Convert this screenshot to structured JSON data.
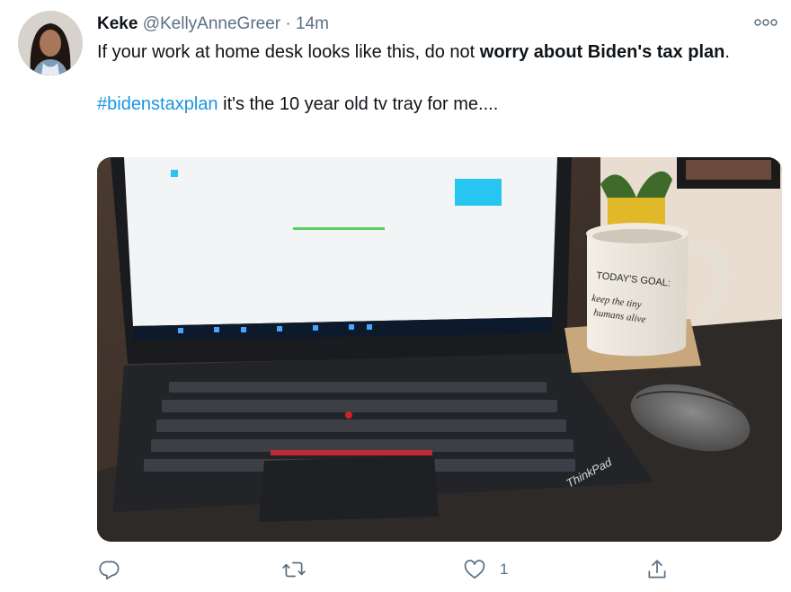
{
  "tweet": {
    "author_name": "Keke",
    "handle": "@KellyAnneGreer",
    "separator": "·",
    "time": "14m",
    "text_normal": "If your work at home desk looks like this, do not ",
    "text_bold": "worry about Biden's tax plan",
    "text_end": ".",
    "hashtag": "#bidenstaxplan",
    "text_line2": " it's the 10 year old tv tray for me....",
    "like_count": "1"
  },
  "photo": {
    "laptop_brand": "ThinkPad",
    "mug_line1": "TODAY'S GOAL:",
    "mug_line2": "keep the tiny",
    "mug_line3": "humans alive"
  },
  "icons": {
    "more": "more-icon",
    "reply": "reply-icon",
    "retweet": "retweet-icon",
    "like": "like-icon",
    "share": "share-icon"
  },
  "colors": {
    "hashtag": "#1b95e0",
    "secondary_text": "#5b7083"
  }
}
